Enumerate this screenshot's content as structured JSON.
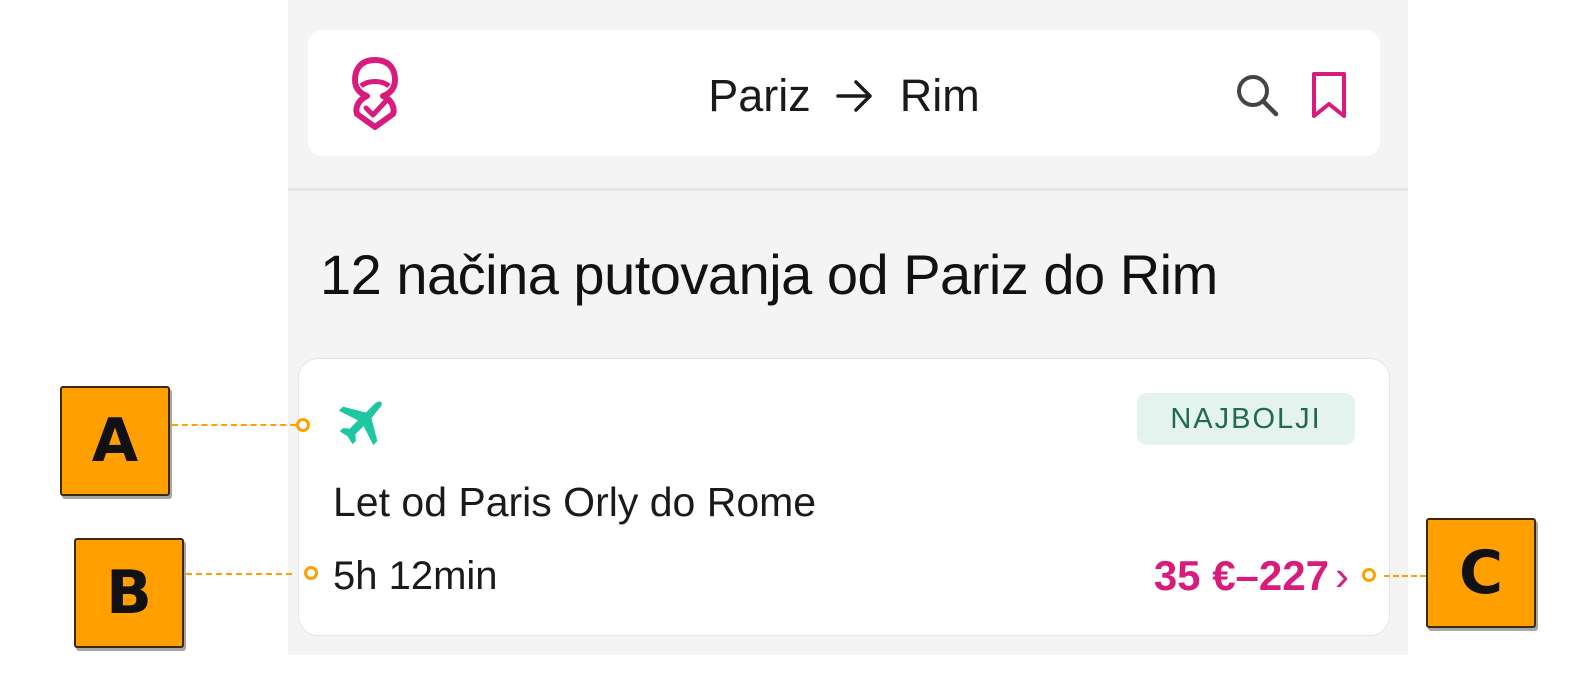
{
  "header": {
    "origin": "Pariz",
    "destination": "Rim"
  },
  "results": {
    "heading": "12 načina putovanja od Pariz do Rim"
  },
  "card": {
    "badge": "NAJBOLJI",
    "title": "Let od Paris Orly do Rome",
    "duration": "5h 12min",
    "price": "35 €–227",
    "chevron": "›"
  },
  "callouts": {
    "a": "A",
    "b": "B",
    "c": "C"
  },
  "colors": {
    "brand": "#d81b7d",
    "plane": "#1fc6a2",
    "badge_bg": "#e4f3ee",
    "callout": "#ffa000"
  },
  "icons": [
    "logo-icon",
    "arrow-right-icon",
    "search-icon",
    "bookmark-icon",
    "plane-icon"
  ]
}
